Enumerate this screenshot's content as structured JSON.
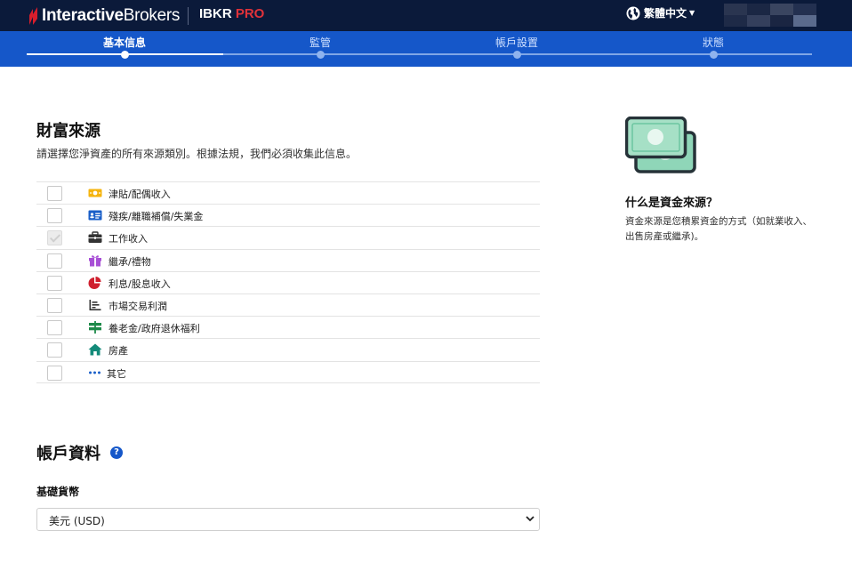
{
  "header": {
    "logo_bold": "Interactive",
    "logo_regular": "Brokers",
    "product_name": "IBKR",
    "product_suffix": "PRO",
    "language": "繁體中文"
  },
  "stepper": {
    "steps": [
      {
        "label": "基本信息",
        "active": true
      },
      {
        "label": "監管",
        "active": false
      },
      {
        "label": "帳戶設置",
        "active": false
      },
      {
        "label": "狀態",
        "active": false
      }
    ]
  },
  "wealth": {
    "title": "財富來源",
    "subtitle": "請選擇您淨資產的所有來源類別。根據法規，我們必須收集此信息。",
    "items": [
      {
        "label": "津貼/配偶收入",
        "icon": "money-bill-icon",
        "checked": false,
        "disabled": false
      },
      {
        "label": "殘疾/離職補償/失業金",
        "icon": "id-card-icon",
        "checked": false,
        "disabled": false
      },
      {
        "label": "工作收入",
        "icon": "briefcase-icon",
        "checked": true,
        "disabled": true
      },
      {
        "label": "繼承/禮物",
        "icon": "gift-icon",
        "checked": false,
        "disabled": false
      },
      {
        "label": "利息/股息收入",
        "icon": "pie-chart-icon",
        "checked": false,
        "disabled": false
      },
      {
        "label": "市場交易利潤",
        "icon": "bar-chart-icon",
        "checked": false,
        "disabled": false
      },
      {
        "label": "養老金/政府退休福利",
        "icon": "signpost-icon",
        "checked": false,
        "disabled": false
      },
      {
        "label": "房產",
        "icon": "house-icon",
        "checked": false,
        "disabled": false
      },
      {
        "label": "其它",
        "icon": "ellipsis-icon",
        "checked": false,
        "disabled": false
      }
    ]
  },
  "account": {
    "title": "帳戶資料",
    "help_symbol": "?",
    "base_currency_label": "基礎貨幣",
    "base_currency_value": "美元 (USD)"
  },
  "side_info": {
    "title": "什么是資金來源？",
    "text": "資金來源是您積累資金的方式（如就業收入、出售房產或繼承)。"
  },
  "colors": {
    "header_bg": "#0b1a3a",
    "stepper_bg": "#1557c9",
    "pro_red": "#e0323a"
  }
}
